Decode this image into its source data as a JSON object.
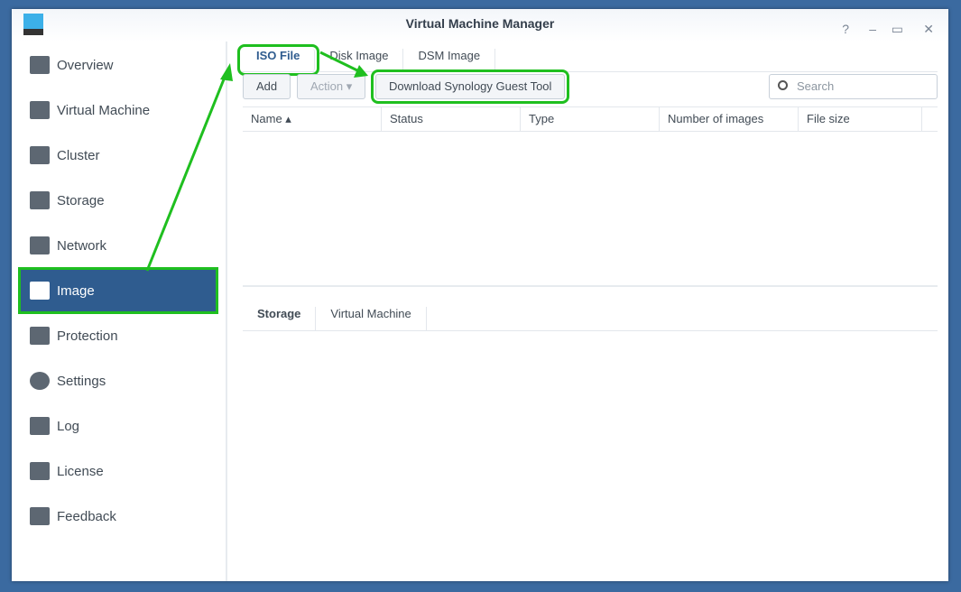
{
  "title": "Virtual Machine Manager",
  "sidebar": [
    "Overview",
    "Virtual Machine",
    "Cluster",
    "Storage",
    "Network",
    "Image",
    "Protection",
    "Settings",
    "Log",
    "License",
    "Feedback"
  ],
  "tabs": [
    "ISO File",
    "Disk Image",
    "DSM Image"
  ],
  "toolbar": {
    "add": "Add",
    "action": "Action ▾",
    "download": "Download Synology Guest Tool",
    "search_placeholder": "Search"
  },
  "columns": [
    "Name ▴",
    "Status",
    "Type",
    "Number of images",
    "File size"
  ],
  "bottom_tabs": [
    "Storage",
    "Virtual Machine"
  ],
  "controls": {
    "help": "?",
    "min": "–",
    "max": "▭",
    "close": "✕"
  }
}
